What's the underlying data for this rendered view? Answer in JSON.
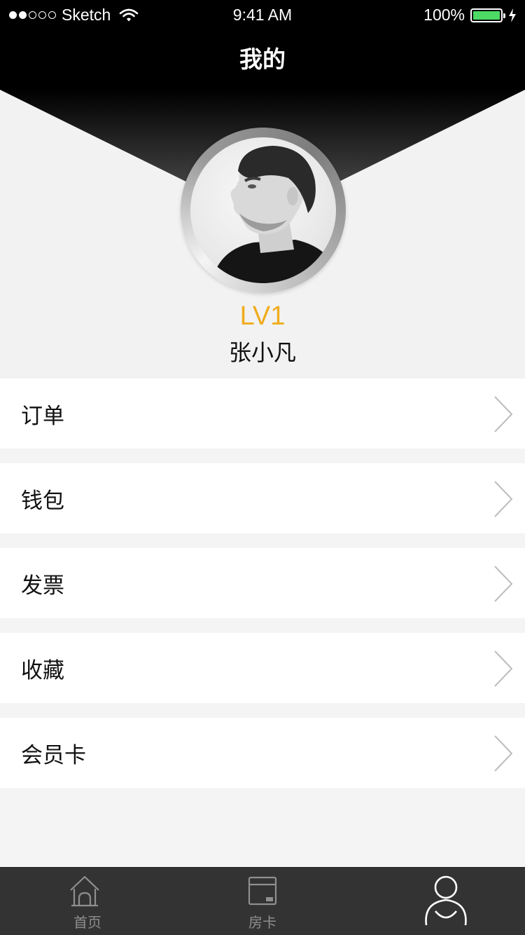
{
  "status_bar": {
    "carrier": "Sketch",
    "time": "9:41 AM",
    "battery": "100%",
    "battery_color": "#4cd964"
  },
  "nav": {
    "title": "我的"
  },
  "profile": {
    "avatar": "avatar-photo",
    "level": "LV1",
    "level_color": "#f0ac1e",
    "name": "张小凡"
  },
  "menu": [
    {
      "label": "订单",
      "icon": "chevron-right-icon"
    },
    {
      "label": "钱包",
      "icon": "chevron-right-icon"
    },
    {
      "label": "发票",
      "icon": "chevron-right-icon"
    },
    {
      "label": "收藏",
      "icon": "chevron-right-icon"
    },
    {
      "label": "会员卡",
      "icon": "chevron-right-icon"
    }
  ],
  "tabs": [
    {
      "label": "首页",
      "icon": "home-icon"
    },
    {
      "label": "房卡",
      "icon": "room-card-icon"
    },
    {
      "label": "",
      "icon": "user-icon",
      "active": true
    }
  ]
}
